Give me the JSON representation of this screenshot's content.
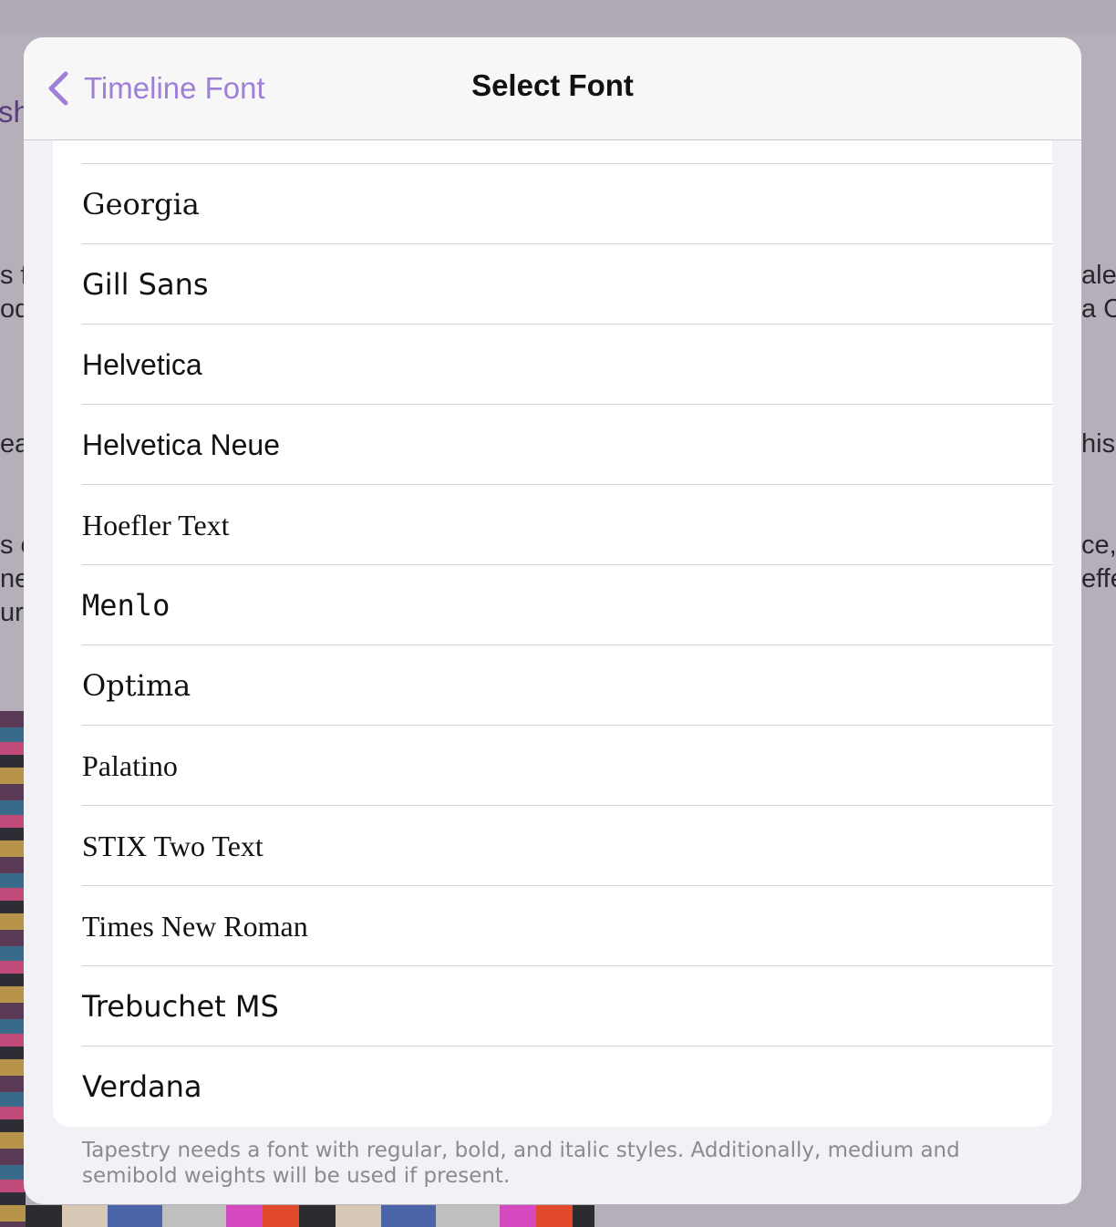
{
  "background": {
    "title_fragment": "sh",
    "left_fragments": [
      "s f",
      "oda",
      "ea",
      "s c",
      "ne",
      "ura"
    ],
    "right_fragments": [
      "ale",
      "a C",
      "his",
      "ce,",
      "effe"
    ]
  },
  "navbar": {
    "back_label": "Timeline Font",
    "title": "Select Font"
  },
  "fonts": [
    {
      "name": "Georgia"
    },
    {
      "name": "Gill Sans"
    },
    {
      "name": "Helvetica"
    },
    {
      "name": "Helvetica Neue"
    },
    {
      "name": "Hoefler Text"
    },
    {
      "name": "Menlo"
    },
    {
      "name": "Optima"
    },
    {
      "name": "Palatino"
    },
    {
      "name": "STIX Two Text"
    },
    {
      "name": "Times New Roman"
    },
    {
      "name": "Trebuchet MS"
    },
    {
      "name": "Verdana"
    }
  ],
  "footer": {
    "note": "Tapestry needs a font with regular, bold, and italic styles. Additionally, medium and semibold weights will be used if present."
  },
  "colors": {
    "accent": "#a07fd6",
    "sheet_background": "#f2f1f6",
    "separator": "#d1d1d6"
  }
}
